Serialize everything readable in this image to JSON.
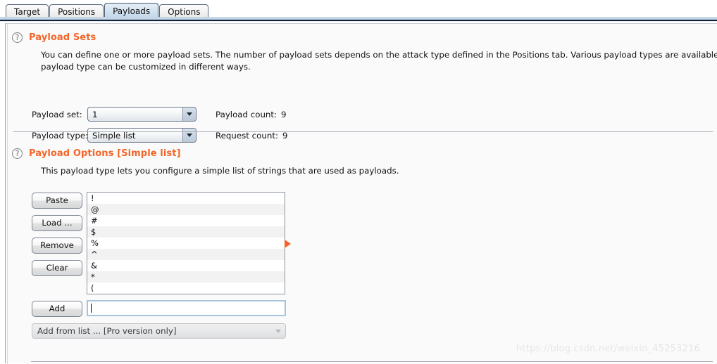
{
  "tabs": [
    {
      "label": "Target",
      "selected": false
    },
    {
      "label": "Positions",
      "selected": false
    },
    {
      "label": "Payloads",
      "selected": true
    },
    {
      "label": "Options",
      "selected": false
    }
  ],
  "payload_sets": {
    "help_icon": "question-mark-icon",
    "title": "Payload Sets",
    "description": "You can define one or more payload sets. The number of payload sets depends on the attack type defined in the Positions tab. Various payload types are available for each pay",
    "description_line2": "payload type can be customized in different ways.",
    "payload_set_label": "Payload set:",
    "payload_set_value": "1",
    "payload_type_label": "Payload type:",
    "payload_type_value": "Simple list",
    "payload_count_label": "Payload count:",
    "payload_count_value": "9",
    "request_count_label": "Request count:",
    "request_count_value": "9"
  },
  "payload_options": {
    "help_icon": "question-mark-icon",
    "title": "Payload Options [Simple list]",
    "description": "This payload type lets you configure a simple list of strings that are used as payloads.",
    "buttons": [
      {
        "label": "Paste",
        "name": "paste-button"
      },
      {
        "label": "Load ...",
        "name": "load-button"
      },
      {
        "label": "Remove",
        "name": "remove-button"
      },
      {
        "label": "Clear",
        "name": "clear-button"
      }
    ],
    "list_items": [
      "!",
      "@",
      "#",
      "$",
      "%",
      "^",
      "&",
      "*",
      "("
    ],
    "marker_icon": "play-triangle-icon",
    "add_button_label": "Add",
    "add_input_value": "",
    "add_input_placeholder": "",
    "add_from_list_label": "Add from list ... [Pro version only]"
  },
  "watermark": "https://blog.csdn.net/weixin_45253216",
  "colors": {
    "accent": "#f2662a",
    "marker": "#f4622a",
    "tab_selected": "#cfe0ef",
    "tab_underline": "#10213c",
    "panel_bg": "#fafafa"
  }
}
